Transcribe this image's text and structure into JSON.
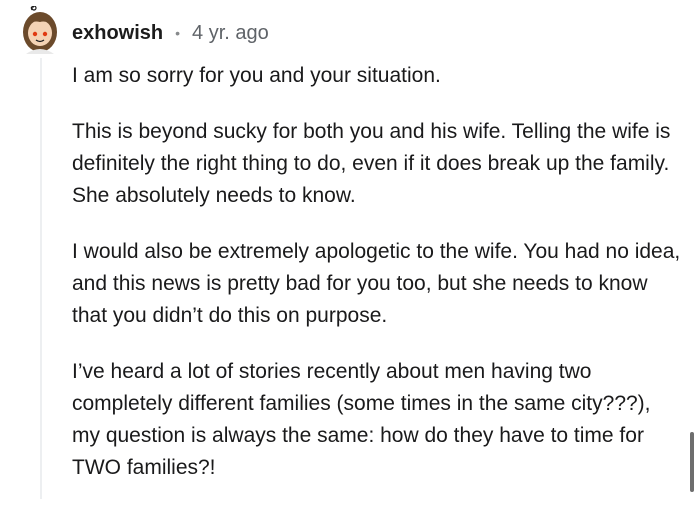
{
  "comment": {
    "username": "exhowish",
    "separator": "•",
    "timestamp": "4 yr. ago",
    "paragraphs": [
      "I am so sorry for you and your situation.",
      "This is beyond sucky for both you and his wife. Telling the wife is definitely the right thing to do, even if it does break up the family. She absolutely needs to know.",
      "I would also be extremely apologetic to the wife. You had no idea, and this news is pretty bad for you too, but she needs to know that you didn’t do this on purpose.",
      "I’ve heard a lot of stories recently about men having two completely different families (some times in the same city???), my question is always the same: how do they have to time for TWO families?!"
    ]
  },
  "icons": {
    "avatar": "reddit-snoo-avatar-icon"
  },
  "colors": {
    "text": "#1a1a1b",
    "meta": "#5f6368",
    "thread_line": "#edeff1",
    "avatar_hair": "#6b4a2b",
    "avatar_bg": "#f4d3b5"
  }
}
